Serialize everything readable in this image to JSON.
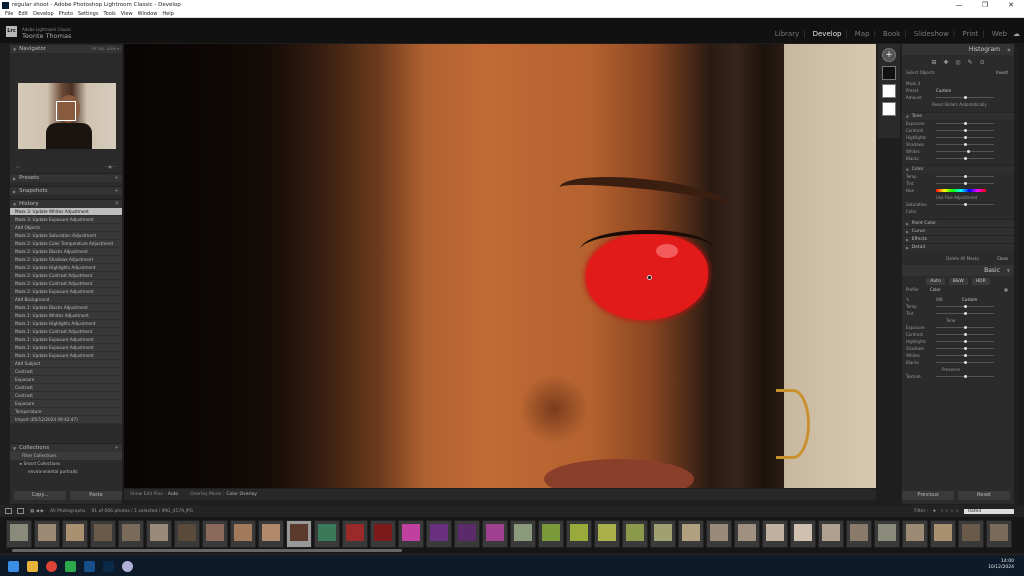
{
  "window": {
    "title": "regular shoot - Adobe Photoshop Lightroom Classic - Develop",
    "controls": [
      "—",
      "❐",
      "✕"
    ]
  },
  "menu": [
    "File",
    "Edit",
    "Develop",
    "Photo",
    "Settings",
    "Tools",
    "View",
    "Window",
    "Help"
  ],
  "identity": {
    "logo": "Lrc",
    "product": "Adobe Lightroom Classic",
    "user": "Teonte Thomas"
  },
  "modules": [
    {
      "label": "Library",
      "active": false
    },
    {
      "label": "Develop",
      "active": true
    },
    {
      "label": "Map",
      "active": false
    },
    {
      "label": "Book",
      "active": false
    },
    {
      "label": "Slideshow",
      "active": false
    },
    {
      "label": "Print",
      "active": false
    },
    {
      "label": "Web",
      "active": false
    }
  ],
  "left": {
    "navigator": {
      "title": "Navigator",
      "zoom": "FIT  FILL  100%  ▾"
    },
    "panels": {
      "presets": "Presets",
      "snapshots": "Snapshots",
      "history": "History",
      "collections": "Collections"
    },
    "history": [
      {
        "label": "Mask 3: Update Whites Adjustment",
        "v": "",
        "sel": true
      },
      {
        "label": "Mask 3: Update Exposure Adjustment",
        "v": "",
        "sel": false
      },
      {
        "label": "Add Objects",
        "v": "",
        "sel": false
      },
      {
        "label": "Mask 2: Update Saturation Adjustment",
        "v": "",
        "sel": false
      },
      {
        "label": "Mask 2: Update Color Temperature Adjustment",
        "v": "",
        "sel": false
      },
      {
        "label": "Mask 2: Update Blacks Adjustment",
        "v": "",
        "sel": false
      },
      {
        "label": "Mask 2: Update Shadows Adjustment",
        "v": "",
        "sel": false
      },
      {
        "label": "Mask 2: Update Highlights Adjustment",
        "v": "",
        "sel": false
      },
      {
        "label": "Mask 2: Update Contrast Adjustment",
        "v": "",
        "sel": false
      },
      {
        "label": "Mask 2: Update Contrast Adjustment",
        "v": "",
        "sel": false
      },
      {
        "label": "Mask 2: Update Exposure Adjustment",
        "v": "",
        "sel": false
      },
      {
        "label": "Add Background",
        "v": "",
        "sel": false
      },
      {
        "label": "Mask 1: Update Blacks Adjustment",
        "v": "",
        "sel": false
      },
      {
        "label": "Mask 1: Update Whites Adjustment",
        "v": "",
        "sel": false
      },
      {
        "label": "Mask 1: Update Highlights Adjustment",
        "v": "",
        "sel": false
      },
      {
        "label": "Mask 1: Update Contrast Adjustment",
        "v": "",
        "sel": false
      },
      {
        "label": "Mask 1: Update Exposure Adjustment",
        "v": "",
        "sel": false
      },
      {
        "label": "Mask 1: Update Exposure Adjustment",
        "v": "",
        "sel": false
      },
      {
        "label": "Mask 1: Update Exposure Adjustment",
        "v": "",
        "sel": false
      },
      {
        "label": "Add Subject",
        "v": "",
        "sel": false
      },
      {
        "label": "Contrast",
        "v": "",
        "sel": false
      },
      {
        "label": "Exposure",
        "v": "",
        "sel": false
      },
      {
        "label": "Contrast",
        "v": "",
        "sel": false
      },
      {
        "label": "Contrast",
        "v": "",
        "sel": false
      },
      {
        "label": "Exposure",
        "v": "",
        "sel": false
      },
      {
        "label": "Temperature",
        "v": "",
        "sel": false
      },
      {
        "label": "Import (05/12/2024 09:42:47)",
        "v": "",
        "sel": false
      }
    ],
    "collections": {
      "filter": "Filter Collections",
      "smart": "Smart Collections",
      "env": "environmental portraits"
    },
    "buttons": {
      "copy": "Copy...",
      "paste": "Paste"
    }
  },
  "toolbar": {
    "show_edit_pins": "Show Edit Pins :",
    "pins_val": "Auto",
    "overlay_mode": "Overlay Mode :",
    "overlay_val": "Color Overlay"
  },
  "right": {
    "histogram": "Histogram",
    "select_objects": "Select Objects",
    "invert": "Invert",
    "mask_label": "Mask 3",
    "preset_label": "Preset",
    "preset_val": "Custom",
    "amount_label": "Amount",
    "reset_sliders": "Reset Sliders Automatically",
    "tone": "Tone",
    "tone_sliders": [
      {
        "label": "Exposure",
        "v": "",
        "pos": 0.5
      },
      {
        "label": "Contrast",
        "v": "",
        "pos": 0.5
      },
      {
        "label": "Highlights",
        "v": "",
        "pos": 0.5
      },
      {
        "label": "Shadows",
        "v": "",
        "pos": 0.5
      },
      {
        "label": "Whites",
        "v": "",
        "pos": 0.55
      },
      {
        "label": "Blacks",
        "v": "",
        "pos": 0.5
      }
    ],
    "color": "Color",
    "color_sliders": [
      {
        "label": "Temp",
        "v": "",
        "pos": 0.5
      },
      {
        "label": "Tint",
        "v": "",
        "pos": 0.5
      }
    ],
    "hue_label": "Hue",
    "fine_adj": "Use Fine Adjustment",
    "saturation_label": "Saturation",
    "color_label": "Color",
    "sections": [
      "Point Color",
      "Curve",
      "Effects",
      "Detail"
    ],
    "delete_masks": "Delete All Masks",
    "close": "Close",
    "basic": "Basic",
    "tabs": [
      "Auto",
      "B&W",
      "HDR"
    ],
    "profile": "Profile",
    "profile_val": "Color",
    "wb": "WB",
    "wb_val": "Custom",
    "wb_sliders": [
      {
        "label": "Temp",
        "v": "",
        "pos": 0.5
      },
      {
        "label": "Tint",
        "v": "",
        "pos": 0.5
      }
    ],
    "tone2": "Tone",
    "tone2_sliders": [
      {
        "label": "Exposure",
        "v": "",
        "pos": 0.5
      },
      {
        "label": "Contrast",
        "v": "",
        "pos": 0.5
      },
      {
        "label": "Highlights",
        "v": "",
        "pos": 0.5
      },
      {
        "label": "Shadows",
        "v": "",
        "pos": 0.5
      },
      {
        "label": "Whites",
        "v": "",
        "pos": 0.5
      },
      {
        "label": "Blacks",
        "v": "",
        "pos": 0.5
      }
    ],
    "presence": "Presence",
    "texture": "Texture",
    "previous": "Previous",
    "reset": "Reset"
  },
  "filmbar": {
    "source": "All Photographs",
    "count": "91 of 666 photos / 1 selected / IMG_4179.JPG",
    "filter": "Filter :",
    "stars": "★ ☆☆☆☆",
    "rated": "Rated"
  },
  "taskbar": {
    "time": "14:00",
    "date": "10/12/2024"
  }
}
